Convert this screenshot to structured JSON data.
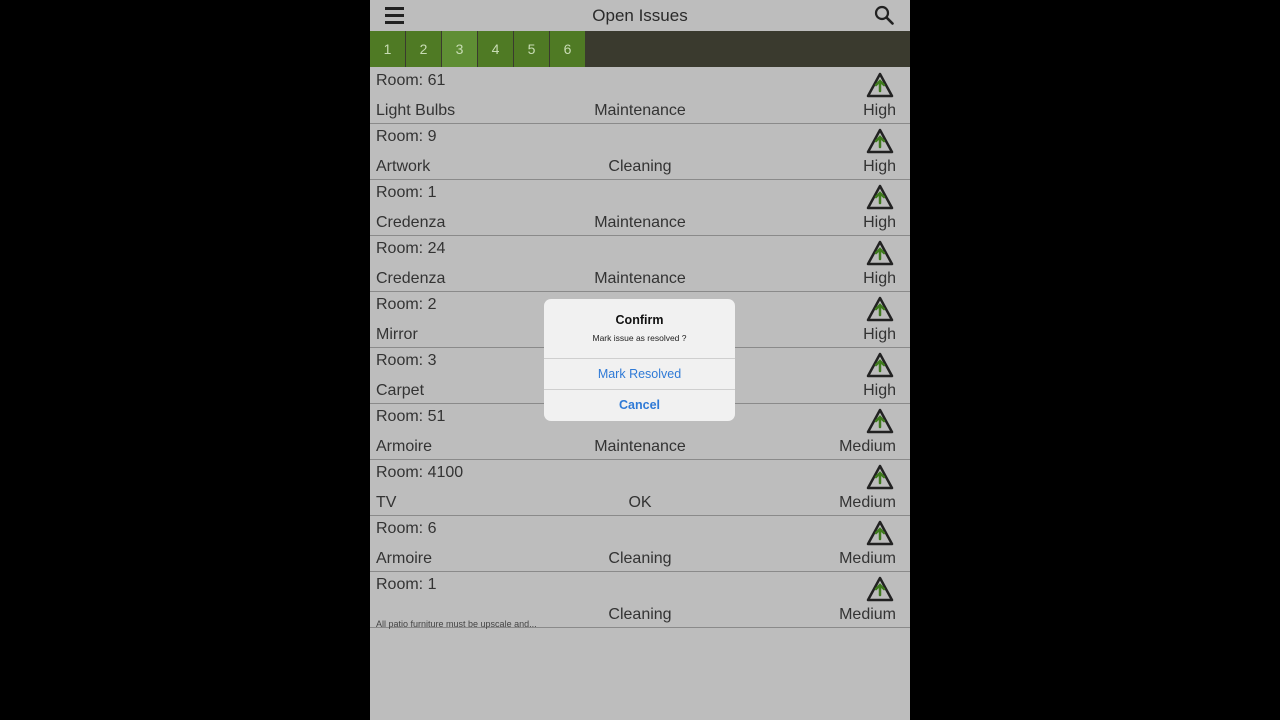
{
  "navbar": {
    "title": "Open Issues",
    "menu_icon": "hamburger-menu-icon",
    "search_icon": "search-icon"
  },
  "pagination": {
    "pages": [
      "1",
      "2",
      "3",
      "4",
      "5",
      "6"
    ],
    "active": "3"
  },
  "issues": [
    {
      "room": "Room: 61",
      "item": "Light Bulbs",
      "category": "Maintenance",
      "priority": "High"
    },
    {
      "room": "Room: 9",
      "item": "Artwork",
      "category": "Cleaning",
      "priority": "High"
    },
    {
      "room": "Room: 1",
      "item": "Credenza",
      "category": "Maintenance",
      "priority": "High"
    },
    {
      "room": "Room: 24",
      "item": "Credenza",
      "category": "Maintenance",
      "priority": "High"
    },
    {
      "room": "Room: 2",
      "item": "Mirror",
      "category": "",
      "priority": "High"
    },
    {
      "room": "Room: 3",
      "item": "Carpet",
      "category": "",
      "priority": "High"
    },
    {
      "room": "Room: 51",
      "item": "Armoire",
      "category": "Maintenance",
      "priority": "Medium"
    },
    {
      "room": "Room: 4100",
      "item": "TV",
      "category": "OK",
      "priority": "Medium"
    },
    {
      "room": "Room: 6",
      "item": "Armoire",
      "category": "Cleaning",
      "priority": "Medium"
    },
    {
      "room": "Room: 1",
      "item": "All patio furniture must be upscale and...",
      "category": "Cleaning",
      "priority": "Medium"
    }
  ],
  "dialog": {
    "title": "Confirm",
    "message": "Mark issue as resolved ?",
    "primary_label": "Mark Resolved",
    "cancel_label": "Cancel"
  },
  "colors": {
    "page_tab": "#4f7a24",
    "page_tab_active": "#5f8e34",
    "dialog_button": "#2f7ad6",
    "background": "#bdbdbd"
  }
}
